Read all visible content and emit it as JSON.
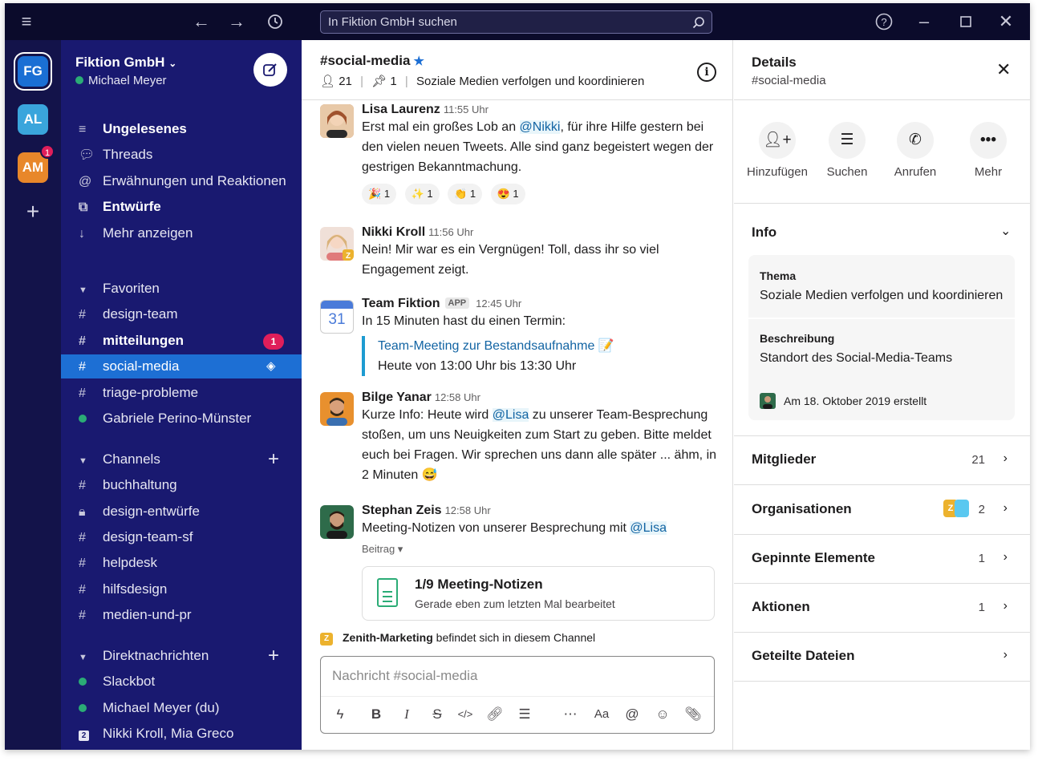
{
  "topbar": {
    "search_placeholder": "In Fiktion GmbH suchen"
  },
  "rail": {
    "workspaces": [
      {
        "initials": "FG",
        "color": "#1a6fd4"
      },
      {
        "initials": "AL",
        "color": "#3aa5dc"
      },
      {
        "initials": "AM",
        "color": "#e8872a",
        "badge": "1"
      }
    ]
  },
  "sidebar": {
    "workspace_name": "Fiktion GmbH",
    "user_name": "Michael Meyer",
    "nav": {
      "unread": "Ungelesenes",
      "threads": "Threads",
      "mentions": "Erwähnungen und Reaktionen",
      "drafts": "Entwürfe",
      "more": "Mehr anzeigen"
    },
    "favorites": {
      "header": "Favoriten",
      "items": [
        "design-team",
        "mitteilungen",
        "social-media",
        "triage-probleme",
        "Gabriele Perino-Münster"
      ],
      "mitteilungen_badge": "1"
    },
    "channels": {
      "header": "Channels",
      "items": [
        "buchhaltung",
        "design-entwürfe",
        "design-team-sf",
        "helpdesk",
        "hilfsdesign",
        "medien-und-pr"
      ]
    },
    "dms": {
      "header": "Direktnachrichten",
      "items": [
        "Slackbot",
        "Michael Meyer (du)",
        "Nikki Kroll, Mia Greco"
      ],
      "group_count": "2"
    }
  },
  "channel": {
    "name": "#social-media",
    "members": "21",
    "pinned": "1",
    "topic": "Soziale Medien verfolgen und koordinieren"
  },
  "messages": [
    {
      "author": "Lisa Laurenz",
      "time": "11:55 Uhr",
      "text_pre": "Erst mal ein großes Lob an ",
      "mention": "@Nikki",
      "text_post": ", für ihre Hilfe gestern bei den vielen neuen Tweets. Alle sind ganz begeistert wegen der gestrigen Bekanntmachung.",
      "reactions": [
        {
          "emoji": "🎉",
          "count": "1"
        },
        {
          "emoji": "✨",
          "count": "1"
        },
        {
          "emoji": "👏",
          "count": "1"
        },
        {
          "emoji": "😍",
          "count": "1"
        }
      ]
    },
    {
      "author": "Nikki Kroll",
      "time": "11:56 Uhr",
      "text": "Nein! Mir war es ein Vergnügen! Toll, dass ihr so viel Engagement zeigt."
    },
    {
      "author": "Team Fiktion",
      "tag": "APP",
      "time": "12:45 Uhr",
      "text": "In 15 Minuten hast du einen Termin:",
      "calendar_day": "31",
      "event_title": "Team-Meeting zur Bestandsaufnahme 📝",
      "event_time": "Heute von 13:00 Uhr bis 13:30 Uhr"
    },
    {
      "author": "Bilge Yanar",
      "time": "12:58 Uhr",
      "text_pre": "Kurze Info: Heute wird ",
      "mention": "@Lisa",
      "text_post": " zu unserer Team-Besprechung stoßen, um uns Neuigkeiten zum Start zu geben. Bitte meldet euch bei Fragen. Wir sprechen uns dann alle später ... ähm, in 2 Minuten 😅"
    },
    {
      "author": "Stephan Zeis",
      "time": "12:58 Uhr",
      "text_pre": "Meeting-Notizen von unserer Besprechung mit ",
      "mention": "@Lisa",
      "post_label": "Beitrag ▾",
      "post_title": "1/9 Meeting-Notizen",
      "post_subtitle": "Gerade eben zum letzten Mal bearbeitet"
    }
  ],
  "org_notice": {
    "badge": "Z",
    "org": "Zenith-Marketing",
    "text": " befindet sich in diesem Channel"
  },
  "composer": {
    "placeholder": "Nachricht #social-media"
  },
  "details": {
    "title": "Details",
    "subtitle": "#social-media",
    "actions": [
      "Hinzufügen",
      "Suchen",
      "Anrufen",
      "Mehr"
    ],
    "info_header": "Info",
    "topic_label": "Thema",
    "topic_value": "Soziale Medien verfolgen und koordinieren",
    "description_label": "Beschreibung",
    "description_value": "Standort des Social-Media-Teams",
    "created": "Am 18. Oktober 2019 erstellt",
    "rows": [
      {
        "label": "Mitglieder",
        "count": "21"
      },
      {
        "label": "Organisationen",
        "count": "2"
      },
      {
        "label": "Gepinnte Elemente",
        "count": "1"
      },
      {
        "label": "Aktionen",
        "count": "1"
      },
      {
        "label": "Geteilte Dateien",
        "count": ""
      }
    ],
    "org_chip_badge": "Z"
  },
  "colors": {
    "topbar": "#0b0b2b",
    "rail": "#13134a",
    "sidebar": "#191970",
    "active": "#1d6fd4",
    "badge": "#e01e5a",
    "online": "#2bac76"
  }
}
